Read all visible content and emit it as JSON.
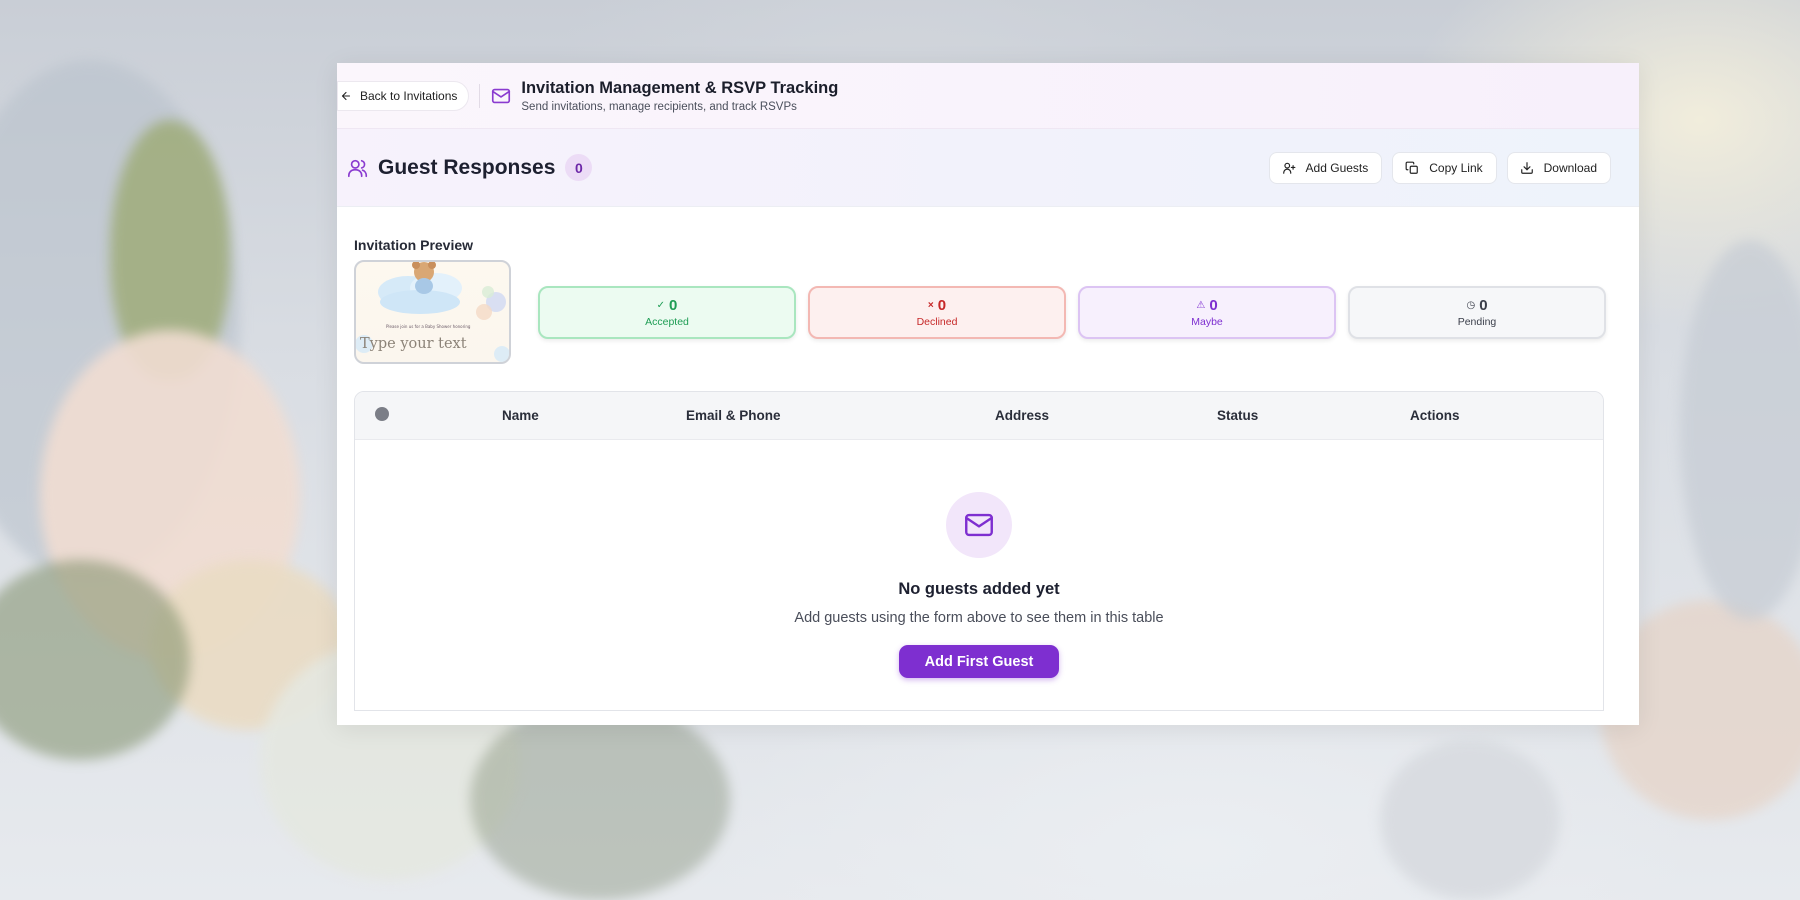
{
  "window": {
    "back_button_label": "Back to Invitations",
    "title": "Invitation Management & RSVP Tracking",
    "subtitle": "Send invitations, manage recipients, and track RSVPs",
    "icon": "mail-icon"
  },
  "responses": {
    "title": "Guest Responses",
    "count": "0",
    "icon": "users-icon",
    "actions": [
      {
        "label": "Add Guests",
        "icon": "user-plus-icon"
      },
      {
        "label": "Copy Link",
        "icon": "copy-icon"
      },
      {
        "label": "Download",
        "icon": "download-icon"
      }
    ]
  },
  "preview": {
    "label": "Invitation Preview",
    "card_text": "Please join us for a Baby Shower honoring",
    "placeholder_text": "Type your text"
  },
  "stats": [
    {
      "key": "accepted",
      "value": "0",
      "label": "Accepted",
      "icon": "check-icon",
      "glyph": "✓",
      "color": "#1f9d55",
      "bg": "#ecfbf1",
      "border": "#a9e6bf"
    },
    {
      "key": "declined",
      "value": "0",
      "label": "Declined",
      "icon": "x-icon",
      "glyph": "×",
      "color": "#c62828",
      "bg": "#fdf0ef",
      "border": "#f3b8b3"
    },
    {
      "key": "maybe",
      "value": "0",
      "label": "Maybe",
      "icon": "alert-triangle-icon",
      "glyph": "⚠",
      "color": "#7e2fd0",
      "bg": "#f7f0fd",
      "border": "#dcc4f3"
    },
    {
      "key": "pending",
      "value": "0",
      "label": "Pending",
      "icon": "clock-icon",
      "glyph": "◷",
      "color": "#3a3e4a",
      "bg": "#f6f7f9",
      "border": "#dfe1e6"
    }
  ],
  "table": {
    "columns": [
      "Name",
      "Email & Phone",
      "Address",
      "Status",
      "Actions"
    ],
    "rows": []
  },
  "empty_state": {
    "icon": "mail-icon",
    "title": "No guests added yet",
    "subtitle": "Add guests using the form above to see them in this table",
    "button_label": "Add First Guest"
  },
  "colors": {
    "accent": "#7e2fd0",
    "accent_light": "#f2e6fa"
  }
}
